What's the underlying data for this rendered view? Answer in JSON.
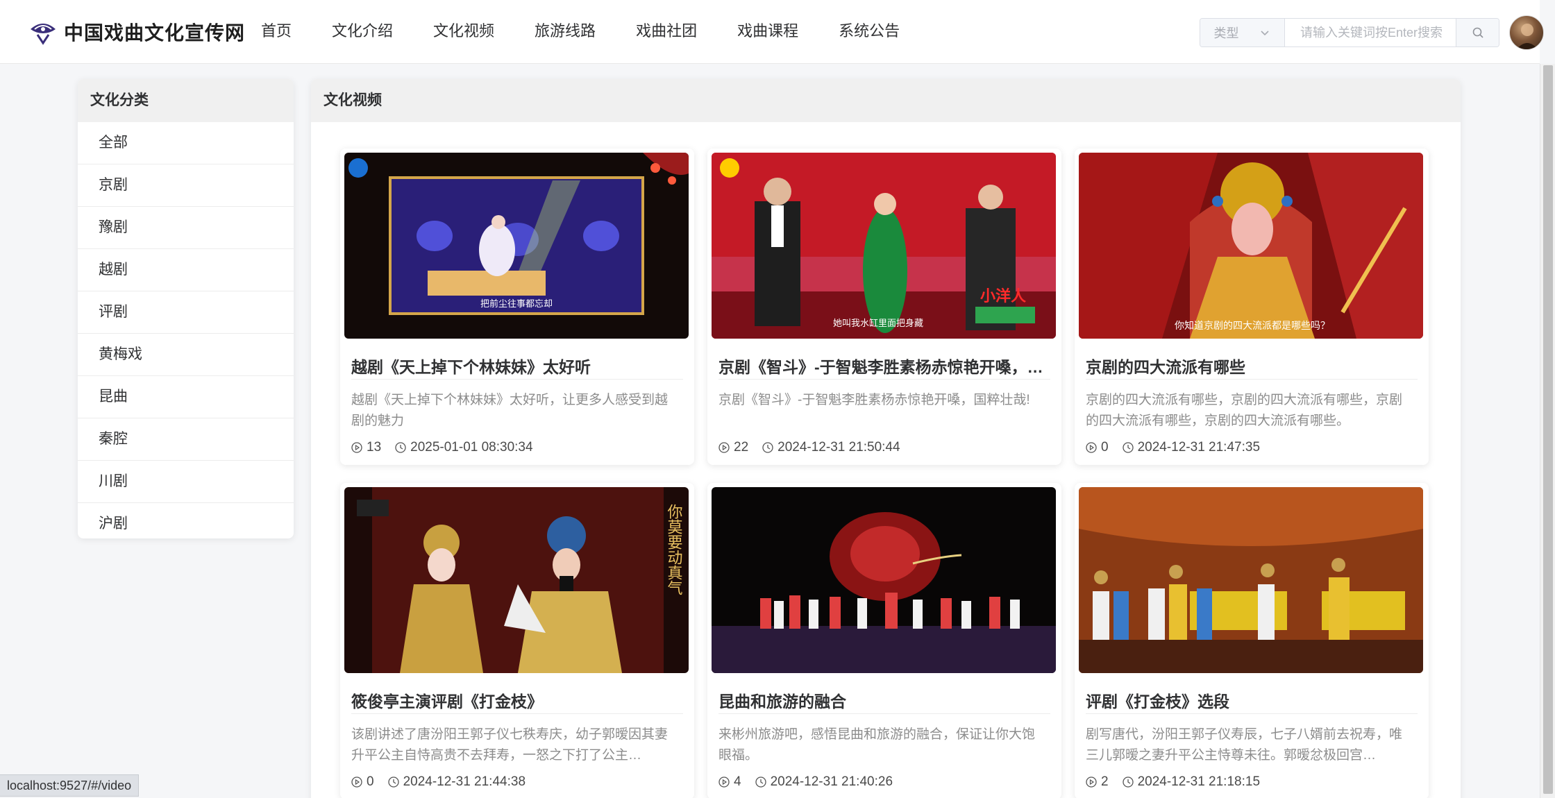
{
  "header": {
    "site_title": "中国戏曲文化宣传网",
    "nav": [
      {
        "label": "首页"
      },
      {
        "label": "文化介绍"
      },
      {
        "label": "文化视频"
      },
      {
        "label": "旅游线路"
      },
      {
        "label": "戏曲社团"
      },
      {
        "label": "戏曲课程"
      },
      {
        "label": "系统公告"
      }
    ],
    "search": {
      "type_label": "类型",
      "placeholder": "请输入关键词按Enter搜索",
      "value": ""
    }
  },
  "sidebar": {
    "title": "文化分类",
    "items": [
      {
        "label": "全部"
      },
      {
        "label": "京剧"
      },
      {
        "label": "豫剧"
      },
      {
        "label": "越剧"
      },
      {
        "label": "评剧"
      },
      {
        "label": "黄梅戏"
      },
      {
        "label": "昆曲"
      },
      {
        "label": "秦腔"
      },
      {
        "label": "川剧"
      },
      {
        "label": "沪剧"
      }
    ]
  },
  "main": {
    "title": "文化视频",
    "videos": [
      {
        "title": "越剧《天上掉下个林妹妹》太好听",
        "desc": "越剧《天上掉下个林妹妹》太好听，让更多人感受到越剧的魅力",
        "views": "13",
        "time": "2025-01-01 08:30:34",
        "caption": "把前尘往事都忘却"
      },
      {
        "title": "京剧《智斗》-于智魁李胜素杨赤惊艳开嗓，国粹壮哉!",
        "desc": "京剧《智斗》-于智魁李胜素杨赤惊艳开嗓，国粹壮哉!",
        "views": "22",
        "time": "2024-12-31 21:50:44",
        "caption": "她叫我水缸里面把身藏"
      },
      {
        "title": "京剧的四大流派有哪些",
        "desc": "京剧的四大流派有哪些，京剧的四大流派有哪些，京剧的四大流派有哪些，京剧的四大流派有哪些。",
        "views": "0",
        "time": "2024-12-31 21:47:35",
        "caption": "你知道京剧的四大流派都是哪些吗？"
      },
      {
        "title": "筱俊亭主演评剧《打金枝》",
        "desc": "该剧讲述了唐汾阳王郭子仪七秩寿庆，幼子郭暧因其妻升平公主自恃高贵不去拜寿，一怒之下打了公主…",
        "views": "0",
        "time": "2024-12-31 21:44:38",
        "caption": "你莫要动真气"
      },
      {
        "title": "昆曲和旅游的融合",
        "desc": "来彬州旅游吧，感悟昆曲和旅游的融合，保证让你大饱眼福。",
        "views": "4",
        "time": "2024-12-31 21:40:26",
        "caption": ""
      },
      {
        "title": "评剧《打金枝》选段",
        "desc": "剧写唐代，汾阳王郭子仪寿辰，七子八婿前去祝寿，唯三儿郭暧之妻升平公主恃尊未往。郭暧忿极回宫…",
        "views": "2",
        "time": "2024-12-31 21:18:15",
        "caption": ""
      }
    ]
  },
  "status_url": "localhost:9527/#/video",
  "colors": {
    "logo": "#3a2e7a",
    "accent_red": "#c8102e"
  }
}
